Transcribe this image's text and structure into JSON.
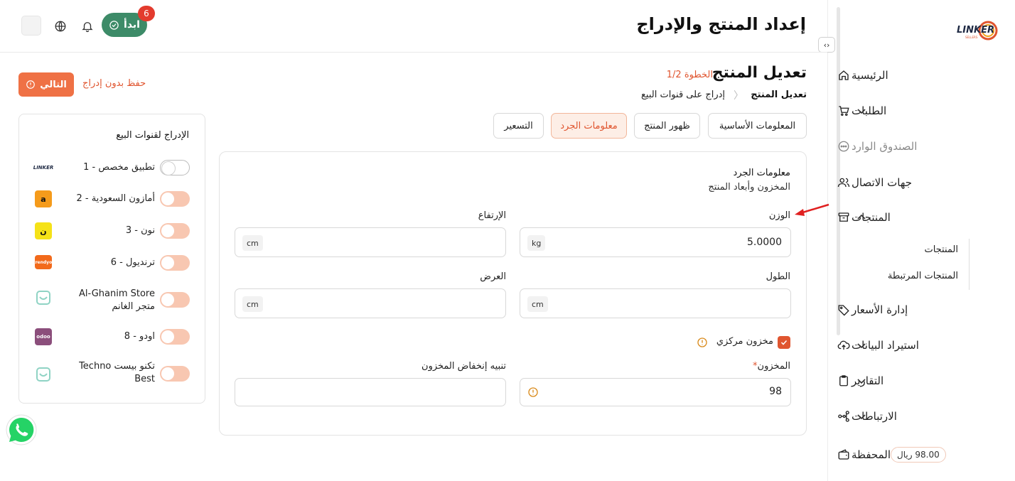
{
  "header": {
    "title": "إعداد المنتج والإدراج",
    "start_label": "ابدأ",
    "notification_count": "6"
  },
  "sidebar": {
    "logo_text": "LINKER",
    "items": [
      {
        "label": "الرئيسية",
        "icon": "home-icon"
      },
      {
        "label": "الطلبات",
        "icon": "cart-icon"
      },
      {
        "label": "الصندوق الوارد",
        "icon": "chat-icon"
      },
      {
        "label": "جهات الاتصال",
        "icon": "users-icon"
      },
      {
        "label": "المنتجات",
        "icon": "box-icon"
      },
      {
        "label": "إدارة الأسعار",
        "icon": "tag-icon"
      },
      {
        "label": "استيراد البيانات",
        "icon": "upload-cloud-icon"
      },
      {
        "label": "التقارير",
        "icon": "clipboard-icon"
      },
      {
        "label": "الارتباطات",
        "icon": "integration-icon"
      },
      {
        "label": "المحفظة",
        "icon": "wallet-icon"
      }
    ],
    "products_sub": [
      "المنتجات",
      "المنتجات المرتبطة"
    ],
    "wallet_balance": "98.00 ريال"
  },
  "main": {
    "title": "تعديل المنتج",
    "step": "الخطوة 1/2",
    "breadcrumb_current": "تعديل المنتج",
    "breadcrumb_next": "إدراج على قنوات البيع",
    "next_label": "التالي",
    "save_label": "حفظ بدون إدراج",
    "tabs": [
      "المعلومات الأساسية",
      "ظهور المنتج",
      "معلومات الجرد",
      "التسعير"
    ]
  },
  "channels": {
    "title": "الإدراج لقنوات البيع",
    "items": [
      {
        "label": "تطبيق مخصص - 1",
        "on": false
      },
      {
        "label": "أمازون السعودية - 2",
        "on": true
      },
      {
        "label": "نون - 3",
        "on": true
      },
      {
        "label": "ترنديول - 6",
        "on": true
      },
      {
        "label": "Al-Ghanim Store متجر الغانم",
        "on": true
      },
      {
        "label": "اودو - 8",
        "on": true
      },
      {
        "label": "تكنو بيست Techno Best",
        "on": true
      }
    ]
  },
  "inventory": {
    "title": "معلومات الجرد",
    "subtitle": "المخزون وأبعاد المنتج",
    "weight_label": "الوزن",
    "weight_value": "5.0000",
    "weight_unit": "kg",
    "height_label": "الإرتفاع",
    "height_unit": "cm",
    "length_label": "الطول",
    "length_unit": "cm",
    "width_label": "العرض",
    "width_unit": "cm",
    "central_stock_label": "مخزون مركزي",
    "stock_label": "المخزون",
    "stock_value": "98",
    "low_stock_label": "تنبيه إنخفاض المخزون"
  },
  "colors": {
    "accent": "#ef7145",
    "accent_text": "#e0552f",
    "start_green": "#3d8b68",
    "badge_red": "#e33b2e"
  }
}
